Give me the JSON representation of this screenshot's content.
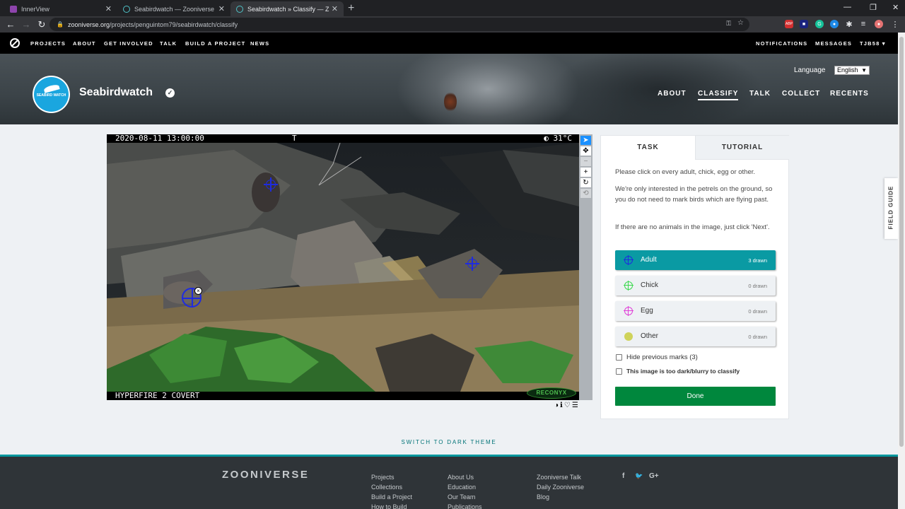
{
  "browser": {
    "tabs": [
      {
        "title": "InnerView",
        "active": false
      },
      {
        "title": "Seabirdwatch — Zooniverse",
        "active": false
      },
      {
        "title": "Seabirdwatch » Classify — Zooni",
        "active": true
      }
    ],
    "url_host": "zooniverse.org",
    "url_path": "/projects/penguintom79/seabirdwatch/classify",
    "extensions": [
      {
        "icon": "abp-icon",
        "label": "ABP",
        "color": "#d32f2f"
      },
      {
        "icon": "extension-blue-icon",
        "label": "■",
        "color": "#1a237e"
      },
      {
        "icon": "grammarly-icon",
        "label": "G",
        "color": "#15c39a"
      },
      {
        "icon": "extension-green-icon",
        "label": "●",
        "color": "#1e88e5"
      },
      {
        "icon": "extension-ring-icon",
        "label": "◎",
        "color": "#0097a7"
      }
    ]
  },
  "topnav": {
    "links": [
      "PROJECTS",
      "ABOUT",
      "GET INVOLVED",
      "TALK",
      "BUILD A PROJECT",
      "NEWS"
    ],
    "right_links": [
      "NOTIFICATIONS",
      "MESSAGES",
      "TJB58 ▾"
    ]
  },
  "project": {
    "title": "Seabirdwatch",
    "avatar_text": "SEABIRD WATCH",
    "language_label": "Language",
    "language_value": "English",
    "nav": [
      "ABOUT",
      "CLASSIFY",
      "TALK",
      "COLLECT",
      "RECENTS"
    ],
    "active_nav": "CLASSIFY"
  },
  "subject": {
    "top_left": "2020-08-11 13:00:00",
    "top_mid": "T",
    "top_right": "◐  31°C",
    "bottom_left": "HYPERFIRE 2 COVERT",
    "brand": "RECONYX"
  },
  "task": {
    "tabs": [
      "TASK",
      "TUTORIAL"
    ],
    "instructions": [
      "Please click on every adult, chick, egg or other.",
      "We're only interested in the petrels on the ground, so you do not need to mark birds which are flying past.",
      "If there are no animals in the image, just click 'Next'."
    ],
    "tools": [
      {
        "label": "Adult",
        "count": "3 drawn",
        "color": "#1e2be0",
        "selected": true
      },
      {
        "label": "Chick",
        "count": "0 drawn",
        "color": "#3bd94e",
        "selected": false
      },
      {
        "label": "Egg",
        "count": "0 drawn",
        "color": "#e040d8",
        "selected": false
      },
      {
        "label": "Other",
        "count": "0 drawn",
        "color": "#cfd35a",
        "selected": false
      }
    ],
    "hide_marks": "Hide previous marks (3)",
    "too_dark": "This image is too dark/blurry to classify",
    "done": "Done"
  },
  "field_guide": "FIELD GUIDE",
  "switch_theme": "SWITCH TO DARK THEME",
  "footer": {
    "logo": "ZOONIVERSE",
    "col1": [
      "Projects",
      "Collections",
      "Build a Project",
      "How to Build"
    ],
    "col2": [
      "About Us",
      "Education",
      "Our Team",
      "Publications"
    ],
    "col3": [
      "Zooniverse Talk",
      "Daily Zooniverse",
      "Blog"
    ],
    "social": [
      "f",
      "🐦",
      "G+"
    ]
  }
}
